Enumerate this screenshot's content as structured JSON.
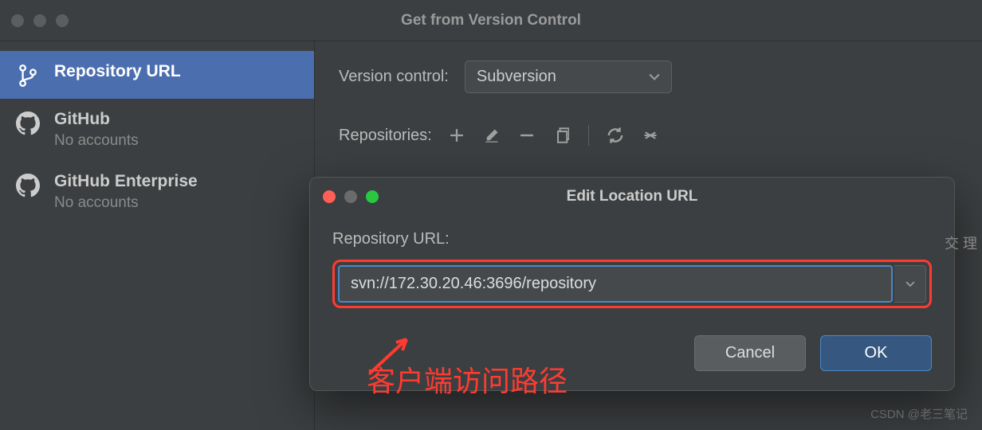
{
  "mainWindow": {
    "title": "Get from Version Control"
  },
  "sidebar": {
    "items": [
      {
        "title": "Repository URL",
        "sub": ""
      },
      {
        "title": "GitHub",
        "sub": "No accounts"
      },
      {
        "title": "GitHub Enterprise",
        "sub": "No accounts"
      }
    ]
  },
  "content": {
    "vcLabel": "Version control:",
    "vcValue": "Subversion",
    "repoLabel": "Repositories:"
  },
  "dialog": {
    "title": "Edit Location URL",
    "label": "Repository URL:",
    "url": "svn://172.30.20.46:3696/repository",
    "cancel": "Cancel",
    "ok": "OK"
  },
  "annotation": {
    "text": "客户端访问路径"
  },
  "watermark": "CSDN @老三笔记",
  "sideChars": "交\n理"
}
